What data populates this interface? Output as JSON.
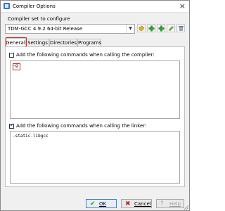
{
  "window": {
    "title": "Compiler Options",
    "close_glyph": "×"
  },
  "compiler_set": {
    "label": "Compiler set to configure",
    "selected": "TDM-GCC 4.9.2 64-bit Release"
  },
  "toolbar_icons": [
    "rename-icon",
    "add-icon",
    "add-icon-2",
    "rename-link-icon",
    "delete-icon"
  ],
  "tabs": [
    {
      "label": "General"
    },
    {
      "label": "Settings"
    },
    {
      "label": "Directories"
    },
    {
      "label": "Programs"
    }
  ],
  "compiler_section": {
    "checkbox_label": "Add the following commands when calling the compiler:",
    "checked": false,
    "value": "-g"
  },
  "linker_section": {
    "checkbox_label": "Add the following commands when calling the linker:",
    "checked": true,
    "value": "-static-libgcc"
  },
  "buttons": {
    "ok_label": "OK",
    "cancel_label": "Cancel",
    "help_label": "Help",
    "ok_glyph": "✔",
    "cancel_glyph": "✖",
    "help_glyph": "?"
  },
  "colors": {
    "highlight": "#e02020",
    "ok_check": "#2e9a2e",
    "cancel_x": "#c42020",
    "accent": "#3c7fd8"
  }
}
